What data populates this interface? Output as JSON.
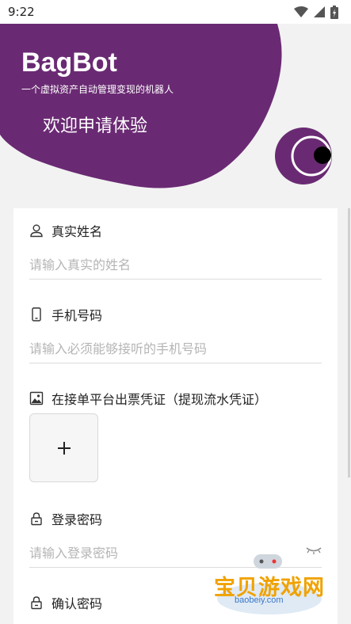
{
  "status_bar": {
    "time": "9:22"
  },
  "hero": {
    "title": "BagBot",
    "subtitle": "一个虚拟资产自动管理变现的机器人",
    "welcome": "欢迎申请体验",
    "brand_color": "#6a2a73"
  },
  "form": {
    "name": {
      "label": "真实姓名",
      "placeholder": "请输入真实的姓名"
    },
    "phone": {
      "label": "手机号码",
      "placeholder": "请输入必须能够接听的手机号码"
    },
    "voucher": {
      "label": "在接单平台出票凭证（提现流水凭证）",
      "add_symbol": "+"
    },
    "password": {
      "label": "登录密码",
      "placeholder": "请输入登录密码"
    },
    "confirm_password": {
      "label": "确认密码"
    }
  },
  "watermark": {
    "text": "宝贝游戏网",
    "url": "baobeiy.com"
  }
}
